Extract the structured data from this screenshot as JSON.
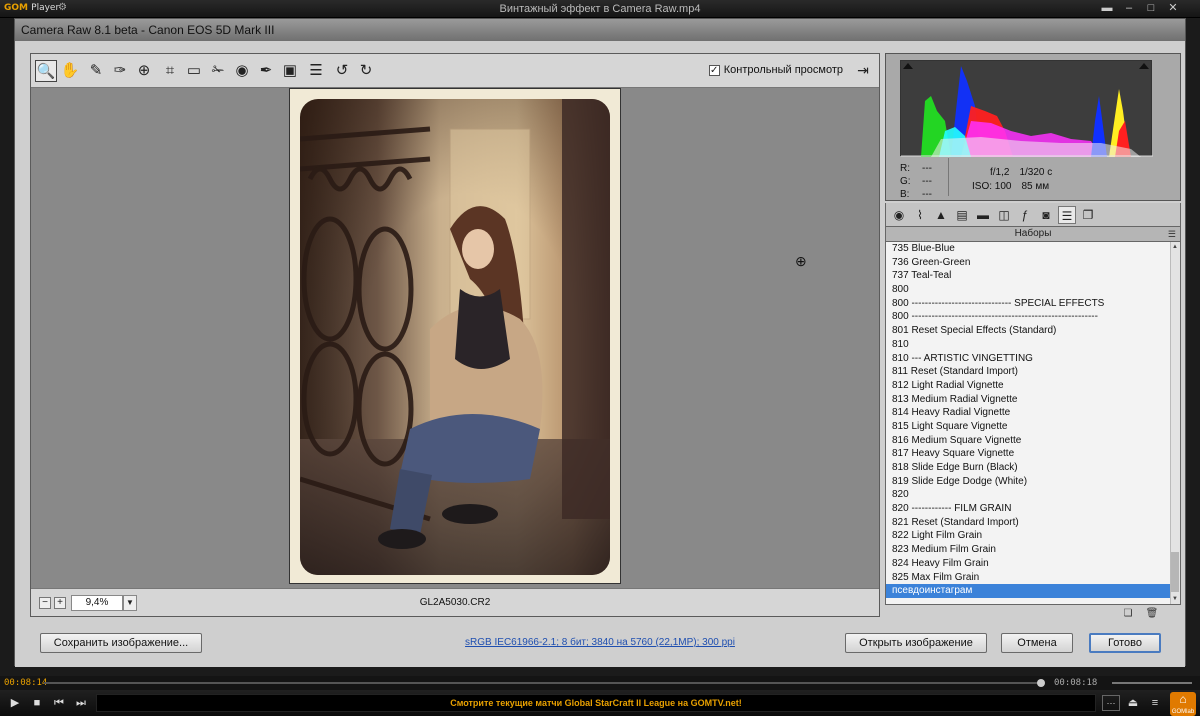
{
  "player": {
    "logo_brand": "GOM",
    "logo_suffix": "Player",
    "window_title": "Винтажный эффект в Camera Raw.mp4",
    "time_current": "00:08:14",
    "time_total": "00:08:18",
    "ticker": "Смотрите текущие матчи Global StarCraft II League на GOMTV.net!",
    "home_label": "GOMlab",
    "accent_color": "#e8a000"
  },
  "camera_raw": {
    "title": "Camera Raw 8.1 beta  -  Canon EOS 5D Mark III",
    "toolbar": {
      "preview_label": "Контрольный просмотр",
      "preview_checked": true
    },
    "zoom": "9,4%",
    "filename": "GL2A5030.CR2",
    "histogram": {
      "r_label": "R:",
      "r_value": "---",
      "g_label": "G:",
      "g_value": "---",
      "b_label": "B:",
      "b_value": "---",
      "aperture": "f/1,2",
      "shutter": "1/320 с",
      "iso": "ISO: 100",
      "focal": "85 мм"
    },
    "presets": {
      "header": "Наборы",
      "items": [
        "735 Blue-Blue",
        "736 Green-Green",
        "737 Teal-Teal",
        "800",
        "800 ------------------------------ SPECIAL EFFECTS",
        "800 --------------------------------------------------------",
        "801 Reset Special Effects (Standard)",
        "810",
        "810 --- ARTISTIC VINGETTING",
        "811 Reset (Standard Import)",
        "812 Light Radial Vignette",
        "813 Medium Radial Vignette",
        "814 Heavy Radial Vignette",
        "815 Light Square Vignette",
        "816 Medium Square Vignette",
        "817 Heavy Square Vignette",
        "818 Slide Edge Burn (Black)",
        "819 Slide Edge Dodge (White)",
        "820",
        "820 ------------ FILM GRAIN",
        "821 Reset (Standard Import)",
        "822 Light Film Grain",
        "823 Medium Film Grain",
        "824 Heavy Film Grain",
        "825 Max Film Grain",
        "псевдоинстаграм"
      ],
      "selected_index": 25
    },
    "buttons": {
      "save": "Сохранить изображение...",
      "open": "Открыть изображение",
      "cancel": "Отмена",
      "done": "Готово"
    },
    "workflow_link": "sRGB IEC61966-2.1; 8 бит; 3840 на 5760 (22,1MP); 300 ppi"
  }
}
